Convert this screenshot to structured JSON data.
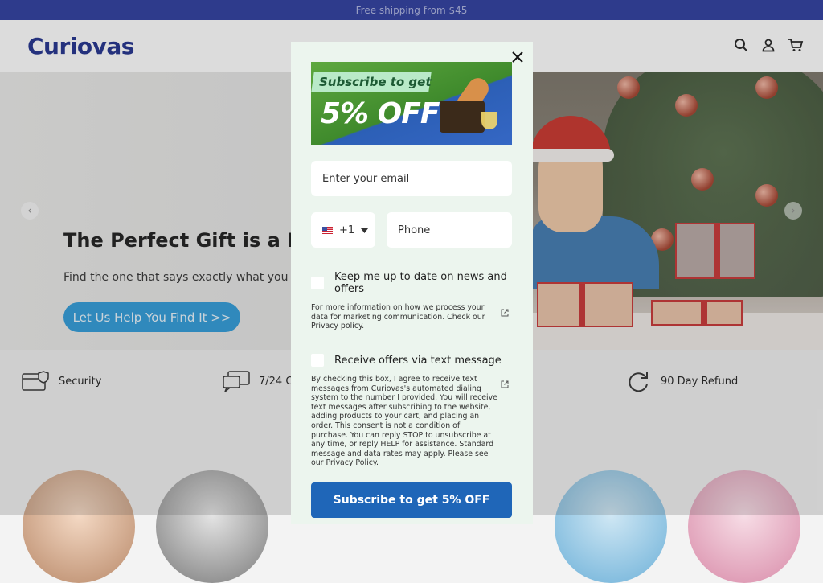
{
  "announcement": {
    "text": "Free shipping from $45"
  },
  "header": {
    "logo": "Curiovas"
  },
  "hero": {
    "title": "The Perfect Gift is a Fee",
    "subtitle": "Find the one that says exactly what you r",
    "cta_label": "Let Us Help You Find It >>"
  },
  "features": [
    {
      "label": "Security"
    },
    {
      "label": "7/24 C"
    },
    {
      "label": "90 Day Refund"
    }
  ],
  "modal": {
    "promo_line1": "Subscribe to get",
    "promo_line2": "5% OFF",
    "email_placeholder": "Enter your email",
    "country_code": "+1",
    "phone_placeholder": "Phone",
    "news_checkbox_label": "Keep me up to date on news and offers",
    "privacy_note": "For more information on how we process your data for marketing communication. Check our Privacy policy.",
    "sms_checkbox_label": "Receive offers via text message",
    "sms_terms": "By checking this box, I agree to receive text messages from Curiovas's automated dialing system to the number I provided. You will receive text messages after subscribing to the website, adding products to your cart, and placing an order. This consent is not a condition of purchase. You can reply STOP to unsubscribe at any time, or reply HELP for assistance. Standard message and data rates may apply. Please see our Privacy Policy.",
    "subscribe_label": "Subscribe to get 5% OFF"
  },
  "colors": {
    "announcement_bg": "#2b3b9e",
    "brand_blue": "#1f2f8c",
    "cta_blue": "#2e9ad8",
    "subscribe_blue": "#1f66b8",
    "modal_bg": "#ecf5ee"
  },
  "icons": [
    "search-icon",
    "account-icon",
    "cart-icon",
    "close-icon",
    "external-link-icon",
    "security-icon",
    "chat-icon",
    "refund-icon",
    "chevron-left-icon",
    "chevron-right-icon",
    "us-flag-icon",
    "caret-down-icon"
  ]
}
